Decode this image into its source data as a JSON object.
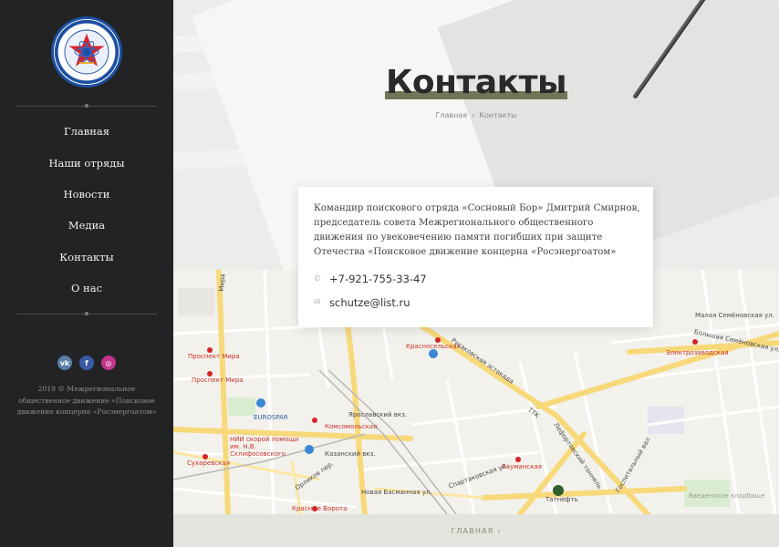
{
  "sidebar": {
    "logo": {
      "top_text": "ПОИСКОВОЕ ДВИЖЕНИЕ",
      "bottom_text": "КОНЦЕРНА РОСЭНЕРГОАТОМ"
    },
    "nav": [
      {
        "label": "Главная"
      },
      {
        "label": "Наши отряды"
      },
      {
        "label": "Новости"
      },
      {
        "label": "Медиа"
      },
      {
        "label": "Контакты"
      },
      {
        "label": "О нас"
      }
    ],
    "socials": [
      {
        "name": "vk-icon",
        "glyph": "vk"
      },
      {
        "name": "facebook-icon",
        "glyph": "f"
      },
      {
        "name": "instagram-icon",
        "glyph": "◎"
      }
    ],
    "copyright": "2019 © Межрегиональное общественное движение «Поисковое движение концерна «Росэнергоатом»"
  },
  "hero": {
    "title": "Контакты",
    "breadcrumb": {
      "home": "Главная",
      "separator": "›",
      "current": "Контакты"
    }
  },
  "contact_card": {
    "description": "Командир поискового отряда «Сосновый Бор» Дмитрий Смирнов, председатель совета Межрегионального общественного движения по увековечению памяти погибших при защите Отечества «Поисковое движение концерна «Росэнергоатом»",
    "phone": "+7-921-755-33-47",
    "email": "schutze@list.ru",
    "phone_icon": "phone-icon",
    "email_icon": "envelope-icon"
  },
  "map": {
    "labels": {
      "prospekt_mira_1": "Проспект Мира",
      "prospekt_mira_2": "Проспект Мира",
      "krasnoselskaya": "Красносельская",
      "komsomolskaya": "Комсомольская",
      "kazansky": "Казанский вкз.",
      "yaroslavsky": "Ярославский вкз.",
      "baumanskaya": "Бауманская",
      "sukharevskaya": "Сухаревская",
      "krasnye_vorota": "Красные Ворота",
      "elektrozavodskaya": "Электрозаводская",
      "eurospar": "EUROSPAR",
      "sklifosovsky": "НИИ скорой помощи им. Н.В. Склифосовского",
      "tatneft": "Татнефть",
      "rusakovskaya": "Русаковская эстакада",
      "lefortovsky": "Лефортовский тоннель",
      "ttk": "ТТК",
      "spartakovskaya": "Спартаковская ул.",
      "novaya_basmannaya": "Новая Басманная ул.",
      "gospitalny": "Госпитальный вал",
      "orlikov": "Орликов пер.",
      "mira_street": "Мира",
      "malaya_semenovskaya": "Малая Семёновская ул.",
      "bolshaya_semenovskaya": "Большая Семёновская ул.",
      "vedenskoe": "Введенское кладбище"
    }
  },
  "footer": {
    "link": "ГЛАВНАЯ",
    "chevron": "›"
  }
}
